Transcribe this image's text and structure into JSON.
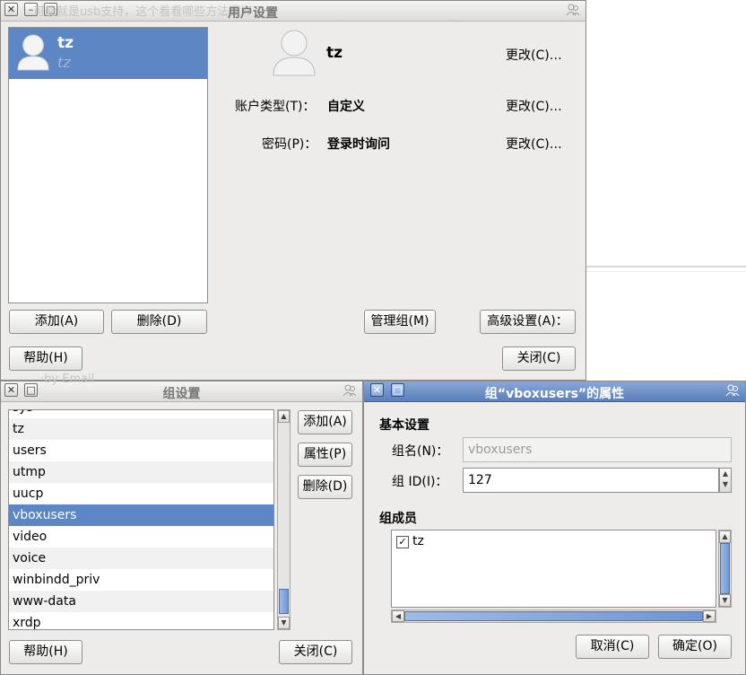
{
  "background": {
    "hint_text": "可能就是usb支持，这个看看哪些方法更好了",
    "hint_text2": "·by Email"
  },
  "user_window": {
    "title": "用户设置",
    "users": [
      {
        "name": "tz",
        "login": "tz"
      }
    ],
    "user_name": "tz",
    "change_label": "更改(C)…",
    "account_type_label": "账户类型(T)：",
    "account_type_value": "自定义",
    "password_label": "密码(P)：",
    "password_value": "登录时询问",
    "buttons": {
      "add": "添加(A)",
      "delete": "删除(D)",
      "manage_groups": "管理组(M)",
      "advanced": "高级设置(A)：",
      "help": "帮助(H)",
      "close": "关闭(C)"
    }
  },
  "group_window": {
    "title": "组设置",
    "groups": [
      "sys",
      "tz",
      "users",
      "utmp",
      "uucp",
      "vboxusers",
      "video",
      "voice",
      "winbindd_priv",
      "www-data",
      "xrdp"
    ],
    "selected": "vboxusers",
    "buttons": {
      "add": "添加(A)",
      "properties": "属性(P)",
      "delete": "删除(D)",
      "help": "帮助(H)",
      "close": "关闭(C)"
    }
  },
  "props_window": {
    "title": "组“vboxusers”的属性",
    "basic_settings": "基本设置",
    "group_name_label": "组名(N)：",
    "group_name_value": "vboxusers",
    "group_id_label": "组 ID(I)：",
    "group_id_value": "127",
    "members_heading": "组成员",
    "members": [
      {
        "name": "tz",
        "checked": true
      }
    ],
    "buttons": {
      "cancel": "取消(C)",
      "ok": "确定(O)"
    }
  },
  "colors": {
    "selection": "#5d86c5",
    "active_titlebar": "#5a7fbb"
  }
}
